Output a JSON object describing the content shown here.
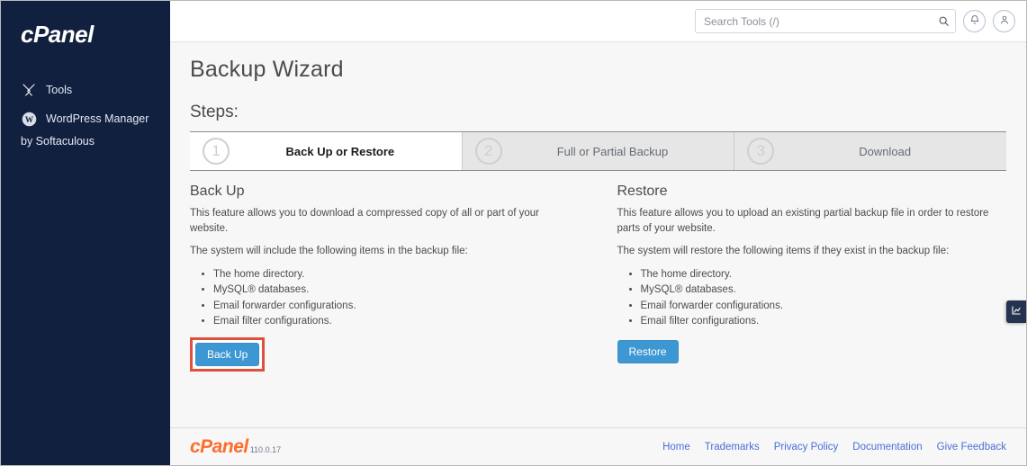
{
  "sidebar": {
    "brand": "cPanel",
    "items": [
      {
        "label": "Tools",
        "icon": "tools-icon"
      },
      {
        "label": "WordPress Manager",
        "icon": "wordpress-icon"
      }
    ],
    "subtext": "by Softaculous"
  },
  "topbar": {
    "search_placeholder": "Search Tools (/)",
    "search_value": "",
    "search_icon": "search-icon",
    "notifications_icon": "bell-icon",
    "account_icon": "user-icon"
  },
  "main": {
    "page_title": "Backup Wizard",
    "steps_label": "Steps:",
    "steps": [
      {
        "number": "1",
        "label": "Back Up or Restore",
        "active": true
      },
      {
        "number": "2",
        "label": "Full or Partial Backup",
        "active": false
      },
      {
        "number": "3",
        "label": "Download",
        "active": false
      }
    ],
    "backup": {
      "title": "Back Up",
      "description": "This feature allows you to download a compressed copy of all or part of your website.",
      "list_intro": "The system will include the following items in the backup file:",
      "items": [
        "The home directory.",
        "MySQL® databases.",
        "Email forwarder configurations.",
        "Email filter configurations."
      ],
      "button_label": "Back Up",
      "highlighted": true,
      "highlight_color": "#e0503c"
    },
    "restore": {
      "title": "Restore",
      "description": "This feature allows you to upload an existing partial backup file in order to restore parts of your website.",
      "list_intro": "The system will restore the following items if they exist in the backup file:",
      "items": [
        "The home directory.",
        "MySQL® databases.",
        "Email forwarder configurations.",
        "Email filter configurations."
      ],
      "button_label": "Restore",
      "highlighted": false
    }
  },
  "footer": {
    "brand": "cPanel",
    "version": "110.0.17",
    "links": [
      "Home",
      "Trademarks",
      "Privacy Policy",
      "Documentation",
      "Give Feedback"
    ]
  },
  "side_tab": {
    "icon": "chart-widget-icon"
  },
  "colors": {
    "sidebar_bg": "#12203f",
    "accent_button": "#3d97d3",
    "brand_orange": "#ff6c2c",
    "link_blue": "#4a6ed8",
    "highlight_red": "#e0503c"
  }
}
